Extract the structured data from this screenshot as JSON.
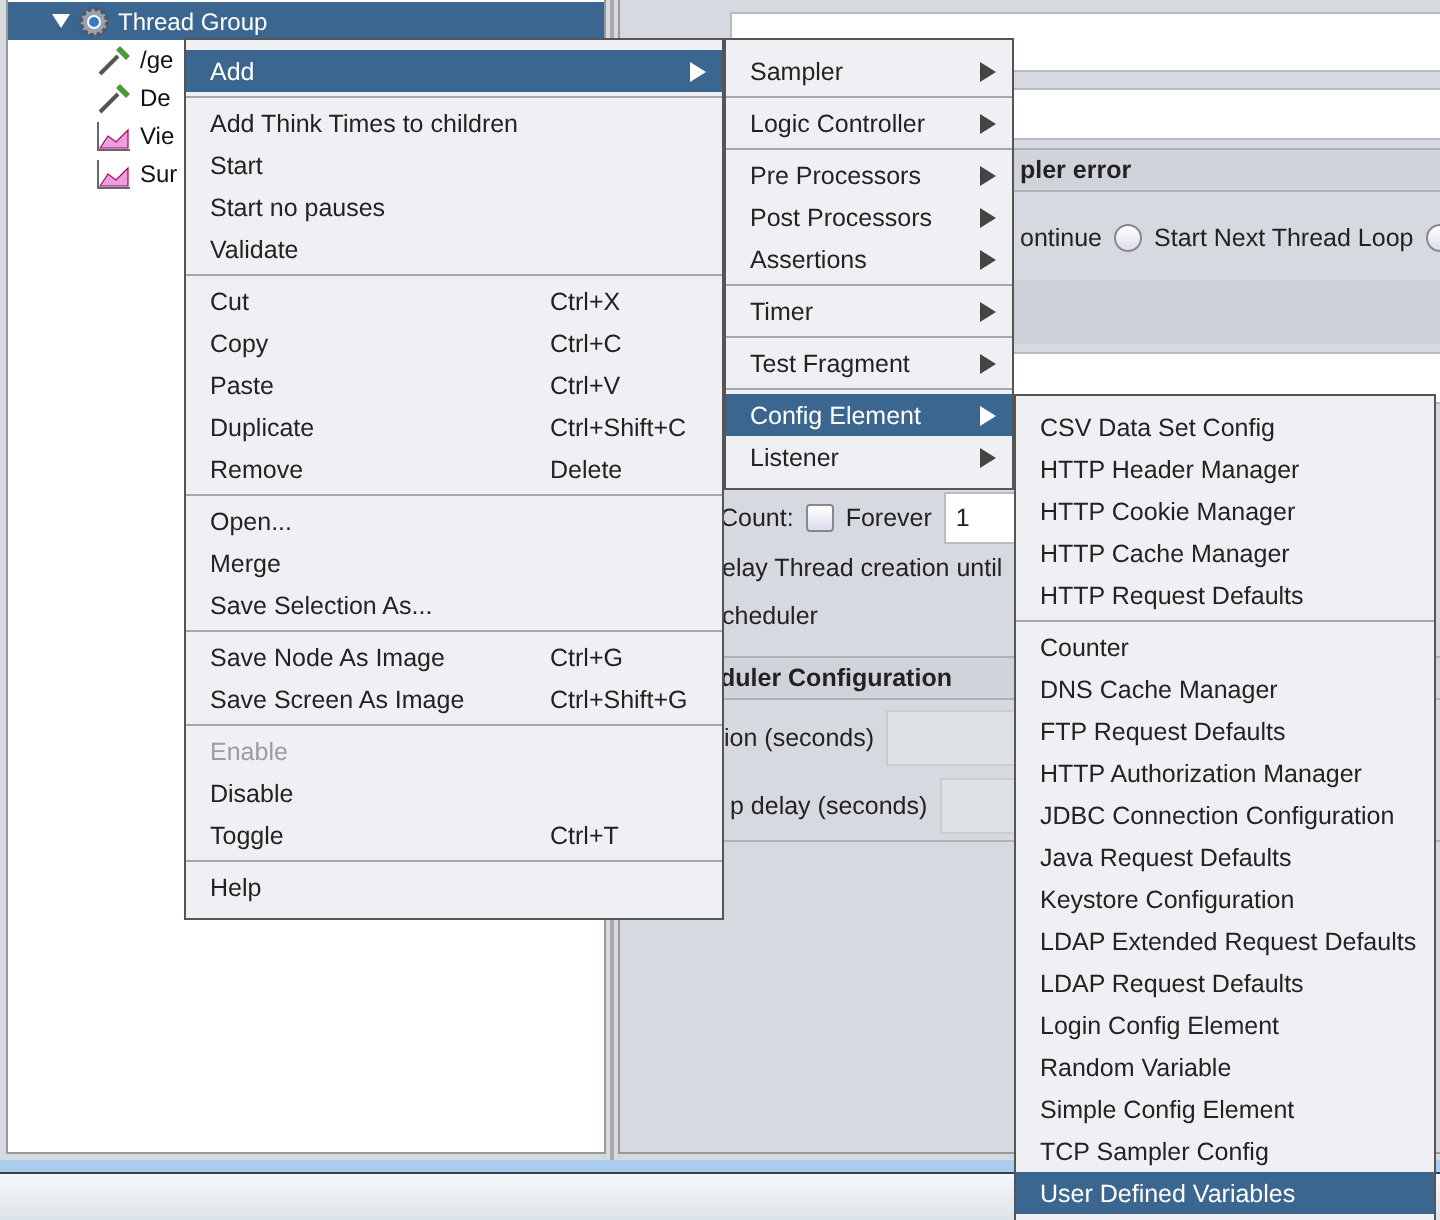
{
  "tree": {
    "items": [
      {
        "label": "Thread Group",
        "selected": true,
        "expanded": true,
        "children": [
          {
            "label": "/ge",
            "kind": "sampler"
          },
          {
            "label": "De",
            "kind": "sampler"
          },
          {
            "label": "Vie",
            "kind": "listener"
          },
          {
            "label": "Sur",
            "kind": "listener"
          }
        ]
      }
    ]
  },
  "panel": {
    "sampler_error_header": "pler error",
    "continue_label": "ontinue",
    "radios": [
      {
        "label": "Start Next Thread Loop",
        "selected": false
      },
      {
        "selected": false
      }
    ],
    "loop_count": {
      "label": "Count:",
      "forever_label": "Forever",
      "forever_checked": false,
      "value": "1"
    },
    "delay_label": "elay Thread creation until",
    "scheduler_label": "cheduler",
    "scheduler_header": "duler Configuration",
    "duration_label": "ion (seconds)",
    "startup_delay_label": "p delay (seconds)"
  },
  "context_menu": {
    "groups": [
      {
        "items": [
          {
            "label": "Add",
            "submenu": true,
            "selected": true,
            "disabled": false
          }
        ]
      },
      {
        "items": [
          {
            "label": "Add Think Times to children",
            "selected": false,
            "disabled": false
          },
          {
            "label": "Start",
            "selected": false,
            "disabled": false
          },
          {
            "label": "Start no pauses",
            "selected": false,
            "disabled": false
          },
          {
            "label": "Validate",
            "selected": false,
            "disabled": false
          }
        ]
      },
      {
        "items": [
          {
            "label": "Cut",
            "shortcut": "Ctrl+X",
            "selected": false,
            "disabled": false
          },
          {
            "label": "Copy",
            "shortcut": "Ctrl+C",
            "selected": false,
            "disabled": false
          },
          {
            "label": "Paste",
            "shortcut": "Ctrl+V",
            "selected": false,
            "disabled": false
          },
          {
            "label": "Duplicate",
            "shortcut": "Ctrl+Shift+C",
            "selected": false,
            "disabled": false
          },
          {
            "label": "Remove",
            "shortcut": "Delete",
            "selected": false,
            "disabled": false
          }
        ]
      },
      {
        "items": [
          {
            "label": "Open...",
            "selected": false,
            "disabled": false
          },
          {
            "label": "Merge",
            "selected": false,
            "disabled": false
          },
          {
            "label": "Save Selection As...",
            "selected": false,
            "disabled": false
          }
        ]
      },
      {
        "items": [
          {
            "label": "Save Node As Image",
            "shortcut": "Ctrl+G",
            "selected": false,
            "disabled": false
          },
          {
            "label": "Save Screen As Image",
            "shortcut": "Ctrl+Shift+G",
            "selected": false,
            "disabled": false
          }
        ]
      },
      {
        "items": [
          {
            "label": "Enable",
            "selected": false,
            "disabled": true
          },
          {
            "label": "Disable",
            "selected": false,
            "disabled": false
          },
          {
            "label": "Toggle",
            "shortcut": "Ctrl+T",
            "selected": false,
            "disabled": false
          }
        ]
      },
      {
        "items": [
          {
            "label": "Help",
            "selected": false,
            "disabled": false
          }
        ]
      }
    ]
  },
  "add_submenu": {
    "groups": [
      {
        "items": [
          {
            "label": "Sampler",
            "submenu": true,
            "selected": false
          }
        ]
      },
      {
        "items": [
          {
            "label": "Logic Controller",
            "submenu": true,
            "selected": false
          }
        ]
      },
      {
        "items": [
          {
            "label": "Pre Processors",
            "submenu": true,
            "selected": false
          },
          {
            "label": "Post Processors",
            "submenu": true,
            "selected": false
          },
          {
            "label": "Assertions",
            "submenu": true,
            "selected": false
          }
        ]
      },
      {
        "items": [
          {
            "label": "Timer",
            "submenu": true,
            "selected": false
          }
        ]
      },
      {
        "items": [
          {
            "label": "Test Fragment",
            "submenu": true,
            "selected": false
          }
        ]
      },
      {
        "items": [
          {
            "label": "Config Element",
            "submenu": true,
            "selected": true
          },
          {
            "label": "Listener",
            "submenu": true,
            "selected": false
          }
        ]
      }
    ]
  },
  "config_submenu": {
    "groups": [
      {
        "items": [
          {
            "label": "CSV Data Set Config",
            "selected": false
          },
          {
            "label": "HTTP Header Manager",
            "selected": false
          },
          {
            "label": "HTTP Cookie Manager",
            "selected": false
          },
          {
            "label": "HTTP Cache Manager",
            "selected": false
          },
          {
            "label": "HTTP Request Defaults",
            "selected": false
          }
        ]
      },
      {
        "items": [
          {
            "label": "Counter",
            "selected": false
          },
          {
            "label": "DNS Cache Manager",
            "selected": false
          },
          {
            "label": "FTP Request Defaults",
            "selected": false
          },
          {
            "label": "HTTP Authorization Manager",
            "selected": false
          },
          {
            "label": "JDBC Connection Configuration",
            "selected": false
          },
          {
            "label": "Java Request Defaults",
            "selected": false
          },
          {
            "label": "Keystore Configuration",
            "selected": false
          },
          {
            "label": "LDAP Extended Request Defaults",
            "selected": false
          },
          {
            "label": "LDAP Request Defaults",
            "selected": false
          },
          {
            "label": "Login Config Element",
            "selected": false
          },
          {
            "label": "Random Variable",
            "selected": false
          },
          {
            "label": "Simple Config Element",
            "selected": false
          },
          {
            "label": "TCP Sampler Config",
            "selected": false
          },
          {
            "label": "User Defined Variables",
            "selected": true
          }
        ]
      }
    ]
  }
}
